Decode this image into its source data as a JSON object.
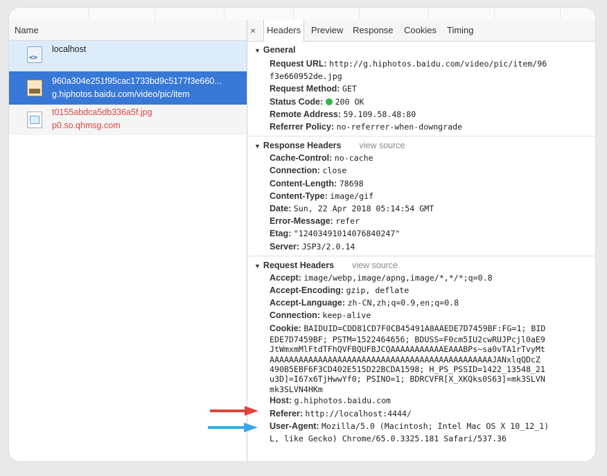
{
  "left_pane": {
    "header": "Name",
    "requests": [
      {
        "name": "localhost",
        "sub": "",
        "icon": "html-document-icon",
        "state": "light-selected"
      },
      {
        "name": "960a304e251f95cac1733bd9c5177f3e660...",
        "sub": "g.hiphotos.baidu.com/video/pic/item",
        "icon": "image-thumbnail-icon",
        "state": "selected"
      },
      {
        "name": "t0155abdca5db336a5f.jpg",
        "sub": "p0.so.qhmsg.com",
        "icon": "broken-image-icon",
        "state": "error"
      }
    ]
  },
  "right_pane": {
    "close": "×",
    "tabs": [
      "Headers",
      "Preview",
      "Response",
      "Cookies",
      "Timing"
    ],
    "active_tab": "Headers",
    "general": {
      "title": "General",
      "request_url_key": "Request URL:",
      "request_url_value_1": "http://g.hiphotos.baidu.com/video/pic/item/96",
      "request_url_value_2": "f3e660952de.jpg",
      "request_method_key": "Request Method:",
      "request_method_value": "GET",
      "status_code_key": "Status Code:",
      "status_code_value": "200 OK",
      "remote_address_key": "Remote Address:",
      "remote_address_value": "59.109.58.48:80",
      "referrer_policy_key": "Referrer Policy:",
      "referrer_policy_value": "no-referrer-when-downgrade"
    },
    "response_headers": {
      "title": "Response Headers",
      "view_source": "view source",
      "items": [
        {
          "k": "Cache-Control:",
          "v": "no-cache"
        },
        {
          "k": "Connection:",
          "v": "close"
        },
        {
          "k": "Content-Length:",
          "v": "78698"
        },
        {
          "k": "Content-Type:",
          "v": "image/gif"
        },
        {
          "k": "Date:",
          "v": "Sun, 22 Apr 2018 05:14:54 GMT"
        },
        {
          "k": "Error-Message:",
          "v": "refer"
        },
        {
          "k": "Etag:",
          "v": "\"12403491014076840247\""
        },
        {
          "k": "Server:",
          "v": "JSP3/2.0.14"
        }
      ]
    },
    "request_headers": {
      "title": "Request Headers",
      "view_source": "view source",
      "accept_key": "Accept:",
      "accept_value": "image/webp,image/apng,image/*,*/*;q=0.8",
      "accept_encoding_key": "Accept-Encoding:",
      "accept_encoding_value": "gzip, deflate",
      "accept_language_key": "Accept-Language:",
      "accept_language_value": "zh-CN,zh;q=0.9,en;q=0.8",
      "connection_key": "Connection:",
      "connection_value": "keep-alive",
      "cookie_key": "Cookie:",
      "cookie_lines": [
        "BAIDUID=CDD81CD7F0CB45491A8AAEDE7D7459BF:FG=1; BID",
        "EDE7D7459BF; PSTM=1522464656; BDUSS=F0cm5IU2cwRUJPcjl0aE9",
        "JtWmxmMlFtdTFhQVFBQUFBJCQAAAAAAAAAAAEAAABPs~sa0vTA1rTvyMt",
        "AAAAAAAAAAAAAAAAAAAAAAAAAAAAAAAAAAAAAAAAAAAAAAJANxlqQDcZ",
        "490B5EBF6F3CD402E515D22BCDA1598; H_PS_PSSID=1422_13548_21",
        "u3D]=I67x6TjHwwYf0; PSINO=1; BDRCVFR[X_XKQks0S63]=mk3SLVN",
        "mk3SLVN4HKm"
      ],
      "host_key": "Host:",
      "host_value": "g.hiphotos.baidu.com",
      "referer_key": "Referer:",
      "referer_value": "http://localhost:4444/",
      "user_agent_key": "User-Agent:",
      "user_agent_value_1": "Mozilla/5.0 (Macintosh; Intel Mac OS X 10_12_1)",
      "user_agent_value_2": "L, like Gecko) Chrome/65.0.3325.181 Safari/537.36"
    }
  },
  "annotations": {
    "red_arrow_color": "#e0443c",
    "blue_arrow_color": "#3ba6e6",
    "status_dot_color": "#2fb74a",
    "selected_row_color": "#3878d7",
    "error_text_color": "#e0443c"
  }
}
